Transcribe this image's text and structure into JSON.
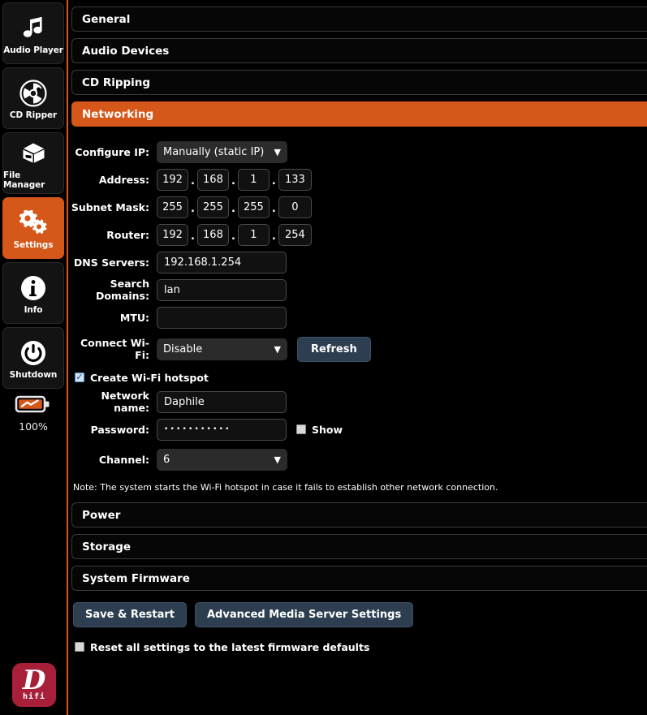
{
  "sidebar": {
    "items": [
      {
        "label": "Audio Player",
        "icon": "music-note-icon",
        "active": false
      },
      {
        "label": "CD Ripper",
        "icon": "cd-disc-icon",
        "active": false
      },
      {
        "label": "File Manager",
        "icon": "box-icon",
        "active": false
      },
      {
        "label": "Settings",
        "icon": "gears-icon",
        "active": true
      },
      {
        "label": "Info",
        "icon": "info-circle-icon",
        "active": false
      },
      {
        "label": "Shutdown",
        "icon": "power-icon",
        "active": false
      }
    ],
    "battery": {
      "percent_label": "100%",
      "icon": "battery-charging-icon"
    },
    "logo": {
      "letter": "D",
      "subtext": "hifi"
    }
  },
  "colors": {
    "accent": "#d5571a",
    "button": "#2c3e50",
    "logo_bg": "#a81f39",
    "input_bg": "#111111",
    "select_bg": "#2b2b2b"
  },
  "panels": [
    {
      "title": "General",
      "active": false
    },
    {
      "title": "Audio Devices",
      "active": false
    },
    {
      "title": "CD Ripping",
      "active": false
    },
    {
      "title": "Networking",
      "active": true
    }
  ],
  "panels_bottom": [
    {
      "title": "Power",
      "active": false
    },
    {
      "title": "Storage",
      "active": false
    },
    {
      "title": "System Firmware",
      "active": false
    }
  ],
  "networking": {
    "configure_ip": {
      "label": "Configure IP:",
      "value": "Manually (static IP)"
    },
    "address": {
      "label": "Address:",
      "octets": [
        "192",
        "168",
        "1",
        "133"
      ]
    },
    "subnet_mask": {
      "label": "Subnet Mask:",
      "octets": [
        "255",
        "255",
        "255",
        "0"
      ]
    },
    "router": {
      "label": "Router:",
      "octets": [
        "192",
        "168",
        "1",
        "254"
      ]
    },
    "dns_servers": {
      "label": "DNS Servers:",
      "value": "192.168.1.254",
      "placeholder": ""
    },
    "search_domains": {
      "label": "Search Domains:",
      "value": "lan",
      "placeholder": ""
    },
    "mtu": {
      "label": "MTU:",
      "value": "",
      "placeholder": ""
    },
    "connect_wifi": {
      "label": "Connect Wi-Fi:",
      "value": "Disable"
    },
    "refresh_button": "Refresh",
    "create_hotspot": {
      "label": "Create Wi-Fi hotspot",
      "checked": true
    },
    "network_name": {
      "label": "Network name:",
      "value": "Daphile"
    },
    "password": {
      "label": "Password:",
      "value": "•••••••••••",
      "show_label": "Show",
      "show_checked": false
    },
    "channel": {
      "label": "Channel:",
      "value": "6"
    },
    "note": "Note: The system starts the Wi-Fi hotspot in case it fails to establish other network connection."
  },
  "actions": {
    "save_restart": "Save & Restart",
    "advanced_media": "Advanced Media Server Settings",
    "reset_label": "Reset all settings to the latest firmware defaults",
    "reset_checked": false
  }
}
